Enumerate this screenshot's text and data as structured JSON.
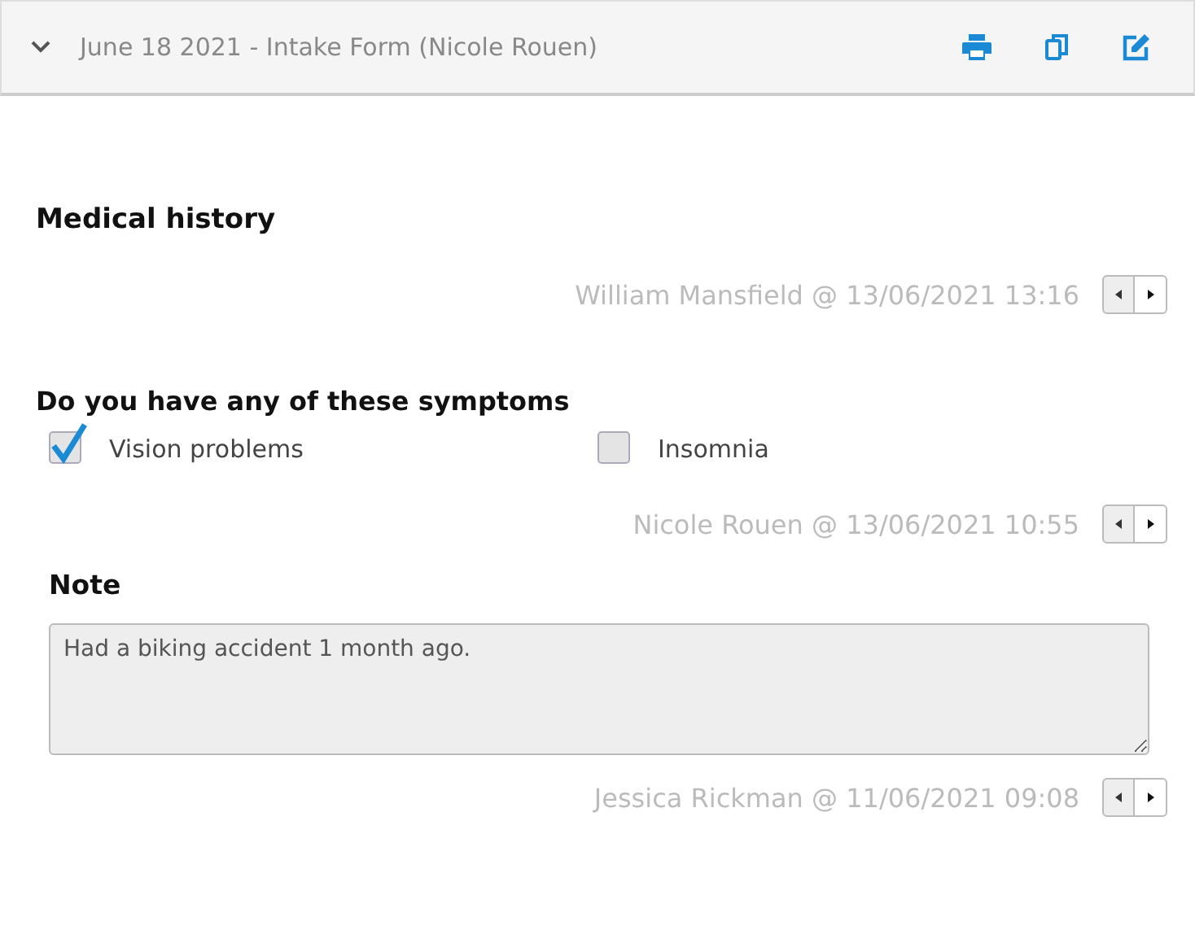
{
  "header": {
    "title": "June 18 2021 - Intake Form (Nicole Rouen)",
    "expanded": true
  },
  "section_title": "Medical history",
  "blocks": [
    {
      "kind": "signature",
      "text": "William Mansfield @ 13/06/2021 13:16"
    },
    {
      "kind": "checkboxes",
      "question": "Do you have any of these symptoms",
      "options": [
        {
          "label": "Vision problems",
          "checked": true
        },
        {
          "label": "Insomnia",
          "checked": false
        }
      ]
    },
    {
      "kind": "signature",
      "text": "Nicole Rouen @ 13/06/2021 10:55"
    },
    {
      "kind": "note",
      "label": "Note",
      "value": "Had a biking accident 1 month ago."
    },
    {
      "kind": "signature",
      "text": "Jessica Rickman @ 11/06/2021 09:08"
    }
  ]
}
